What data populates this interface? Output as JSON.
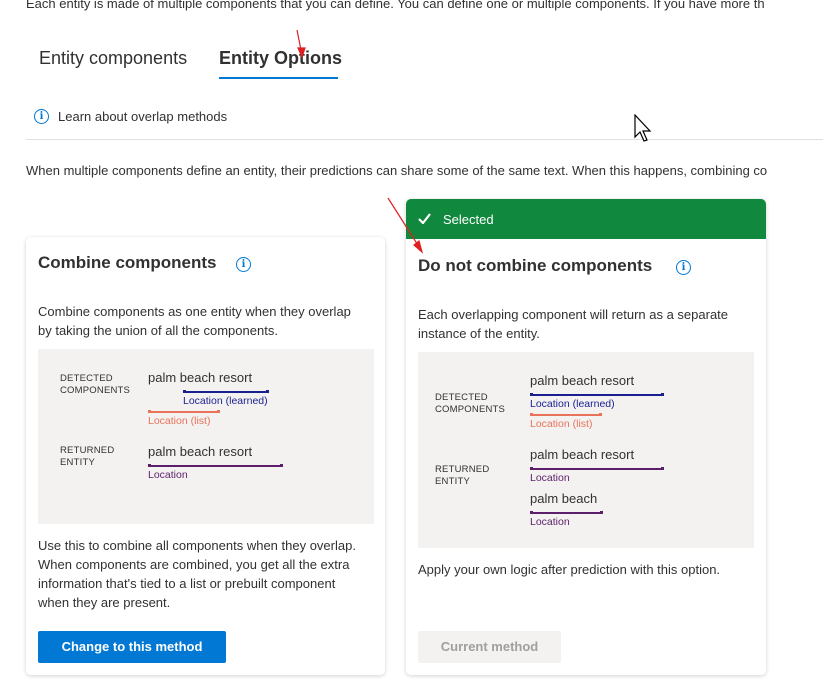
{
  "intro_text": "Each entity is made of multiple components that you can define. You can define one or multiple components. If you have more th",
  "tabs": [
    {
      "label": "Entity components"
    },
    {
      "label": "Entity Options"
    }
  ],
  "info_link": {
    "label": "Learn about overlap methods",
    "icon": "info-icon"
  },
  "description": "When multiple components define an entity, their predictions can share some of the same text. When this happens, combining co",
  "cards": {
    "combine": {
      "title": "Combine components",
      "body": "Combine components as one entity when they overlap by taking the union of all the components.",
      "illustration": {
        "detected_label": [
          "DETECTED",
          "COMPONENTS"
        ],
        "returned_label": [
          "RETURNED",
          "ENTITY"
        ],
        "detected_phrase": "palm beach resort",
        "learned_label": "Location (learned)",
        "list_label": "Location (list)",
        "returned_phrase": "palm beach resort",
        "returned_loc_label": "Location"
      },
      "footer_text": "Use this to combine all components when they overlap. When components are combined, you get all the extra information that's tied to a list or prebuilt component when they are present.",
      "button_label": "Change to this method"
    },
    "separate": {
      "selected_label": "Selected",
      "title": "Do not combine components",
      "body": "Each overlapping component will return as a separate instance of the entity.",
      "illustration": {
        "detected_label": [
          "DETECTED",
          "COMPONENTS"
        ],
        "returned_label": [
          "RETURNED",
          "ENTITY"
        ],
        "detected_phrase": "palm beach resort",
        "learned_label": "Location (learned)",
        "list_label": "Location (list)",
        "returned_phrase_1": "palm beach resort",
        "returned_loc_label_1": "Location",
        "returned_phrase_2": "palm beach",
        "returned_loc_label_2": "Location"
      },
      "footer_text": "Apply your own logic after prediction with this option.",
      "button_label": "Current method"
    }
  },
  "colors": {
    "accent": "#0078d4",
    "selected_green": "#10893e",
    "learned": "#1a1f8f",
    "list": "#e8735a",
    "location": "#5c1f6b"
  }
}
